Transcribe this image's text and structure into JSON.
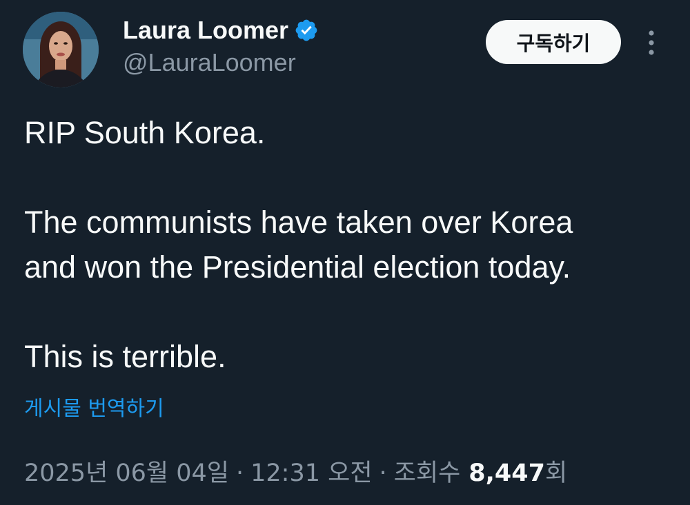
{
  "author": {
    "display_name": "Laura Loomer",
    "handle": "@LauraLoomer",
    "verified_icon": "verified-badge-icon",
    "avatar_icon": "profile-photo"
  },
  "actions": {
    "subscribe_label": "구독하기",
    "more_icon": "more-vertical-icon"
  },
  "tweet": {
    "lines": [
      "RIP South Korea.",
      "The communists have taken over Korea",
      "and won the Presidential election today.",
      "This is terrible."
    ]
  },
  "translate_label": "게시물 번역하기",
  "meta": {
    "date": "2025년 06월 04일",
    "separator": "·",
    "time": "12:31 오전",
    "views_label": "조회수",
    "views_count": "8,447",
    "views_suffix": "회"
  },
  "colors": {
    "background": "#15202b",
    "text": "#f7f9f9",
    "secondary": "#8b98a5",
    "link": "#1d9bf0",
    "verified": "#1d9bf0"
  }
}
